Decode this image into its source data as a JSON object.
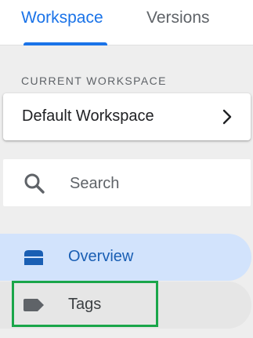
{
  "tabs": {
    "workspace_label": "Workspace",
    "versions_label": "Versions",
    "active": "Workspace"
  },
  "current_workspace": {
    "section_label": "CURRENT WORKSPACE",
    "name": "Default Workspace",
    "chevron_icon": "chevron-right-icon"
  },
  "search": {
    "placeholder": "Search",
    "value": "",
    "icon": "search-icon"
  },
  "nav": {
    "items": [
      {
        "label": "Overview",
        "icon": "overview-icon",
        "selected": true
      },
      {
        "label": "Tags",
        "icon": "tag-icon",
        "selected": false
      }
    ]
  },
  "colors": {
    "accent": "#1a73e8",
    "selected_background": "#d2e3fc",
    "highlight": "#1aa64a",
    "background": "#eeeeee"
  }
}
